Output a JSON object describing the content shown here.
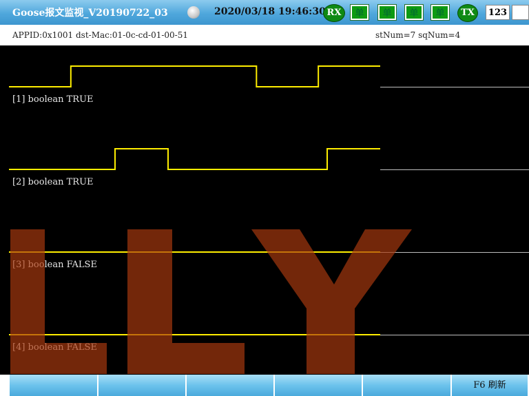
{
  "title_bar": {
    "title": "Goose报文监视_V20190722_03",
    "datetime": "2020/03/18 19:46:30",
    "rx_label": "RX",
    "tx_label": "TX",
    "mode_buttons": [
      "单",
      "单",
      "单",
      "单"
    ],
    "counter": "123"
  },
  "info": {
    "appid_dst": "APPID:0x1001  dst-Mac:01-0c-cd-01-00-51",
    "st_sq": "stNum=7 sqNum=4"
  },
  "channels": [
    {
      "label": "[1] boolean TRUE",
      "value": true,
      "waveform": [
        0,
        1,
        1,
        1,
        0,
        1
      ]
    },
    {
      "label": "[2] boolean TRUE",
      "value": true,
      "waveform": [
        0,
        0,
        1,
        0,
        0,
        0,
        1
      ]
    },
    {
      "label": "[3] boolean FALSE",
      "value": false,
      "waveform": [
        0
      ]
    },
    {
      "label": "[4] boolean FALSE",
      "value": false,
      "waveform": [
        0
      ]
    }
  ],
  "watermark": "LLY",
  "function_keys": [
    "",
    "",
    "",
    "",
    "",
    "F6 刷新"
  ],
  "colors": {
    "signal": "#ffee00",
    "plot_bg": "#000000",
    "indicator_green": "#0f8a14",
    "watermark": "#a33a10"
  }
}
